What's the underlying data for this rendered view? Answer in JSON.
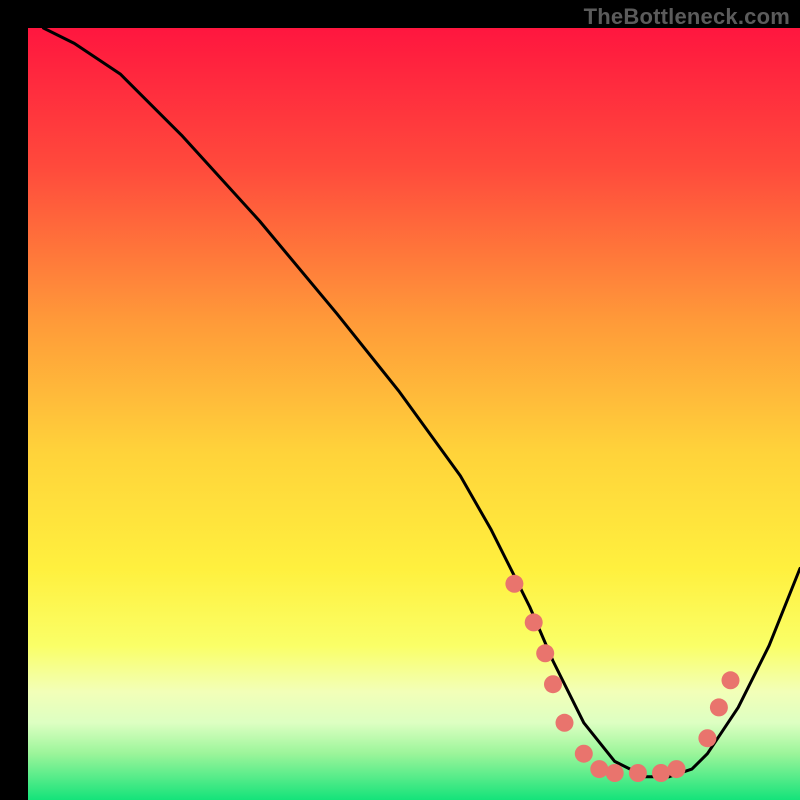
{
  "watermark": "TheBottleneck.com",
  "chart_data": {
    "type": "line",
    "title": "",
    "xlabel": "",
    "ylabel": "",
    "xlim": [
      0,
      100
    ],
    "ylim": [
      0,
      100
    ],
    "background_gradient": {
      "top_color": "#ff163f",
      "mid_color_1": "#ff833b",
      "mid_color_2": "#ffe63a",
      "lower_pale": "#fcff93",
      "near_bottom": "#d4ff7e",
      "bottom_color": "#14e37a"
    },
    "series": [
      {
        "name": "bottleneck-curve",
        "x": [
          2,
          6,
          12,
          20,
          30,
          40,
          48,
          56,
          60,
          63,
          65,
          68,
          72,
          76,
          80,
          83,
          86,
          88,
          92,
          96,
          100
        ],
        "y": [
          100,
          98,
          94,
          86,
          75,
          63,
          53,
          42,
          35,
          29,
          25,
          18,
          10,
          5,
          3,
          3,
          4,
          6,
          12,
          20,
          30
        ]
      }
    ],
    "markers": {
      "name": "highlight-dots",
      "color": "#e9746d",
      "radius": 9,
      "points": [
        {
          "x": 63,
          "y": 28
        },
        {
          "x": 65.5,
          "y": 23
        },
        {
          "x": 67,
          "y": 19
        },
        {
          "x": 68,
          "y": 15
        },
        {
          "x": 69.5,
          "y": 10
        },
        {
          "x": 72,
          "y": 6
        },
        {
          "x": 74,
          "y": 4
        },
        {
          "x": 76,
          "y": 3.5
        },
        {
          "x": 79,
          "y": 3.5
        },
        {
          "x": 82,
          "y": 3.5
        },
        {
          "x": 84,
          "y": 4
        },
        {
          "x": 88,
          "y": 8
        },
        {
          "x": 89.5,
          "y": 12
        },
        {
          "x": 91,
          "y": 15.5
        }
      ]
    }
  }
}
